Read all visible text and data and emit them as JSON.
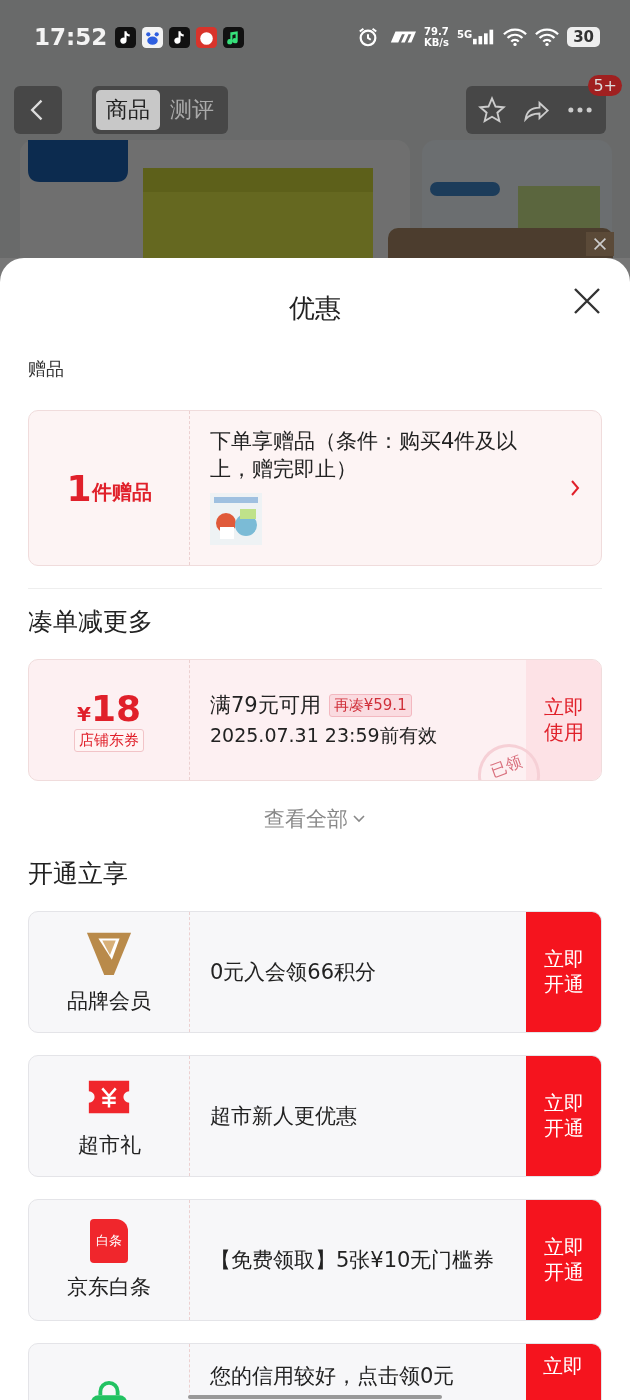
{
  "status_bar": {
    "time": "17:52",
    "net_speed": "79.7",
    "net_unit": "KB/s",
    "network": "5G",
    "battery": "30"
  },
  "nav": {
    "tabs": [
      {
        "label": "商品",
        "selected": true
      },
      {
        "label": "测评",
        "selected": false
      }
    ],
    "badge": "5+"
  },
  "sheet": {
    "title": "优惠",
    "gift_section": {
      "label": "赠品",
      "count": "1",
      "count_unit": "件赠品",
      "text": "下单享赠品（条件：购买4件及以上，赠完即止）"
    },
    "coupon_section": {
      "title": "凑单减更多",
      "coupon": {
        "currency": "¥",
        "amount": "18",
        "type": "店铺东券",
        "condition": "满79元可用",
        "tag": "再凑¥59.1",
        "validity": "2025.07.31 23:59前有效",
        "button": "立即使用",
        "stamp": "已领"
      },
      "view_all": "查看全部"
    },
    "benefit_section": {
      "title": "开通立享",
      "items": [
        {
          "kind": "v-logo",
          "name": "品牌会员",
          "desc": "0元入会领66积分",
          "button": "立即开通"
        },
        {
          "kind": "ticket",
          "name": "超市礼",
          "desc": "超市新人更优惠",
          "button": "立即开通"
        },
        {
          "kind": "card",
          "icon_text": "白条",
          "name": "京东白条",
          "desc": "【免费领取】5张¥10无门槛券",
          "button": "立即开通"
        },
        {
          "kind": "bag",
          "desc": "您的信用较好，点击领0元",
          "button": "立即"
        }
      ]
    }
  }
}
